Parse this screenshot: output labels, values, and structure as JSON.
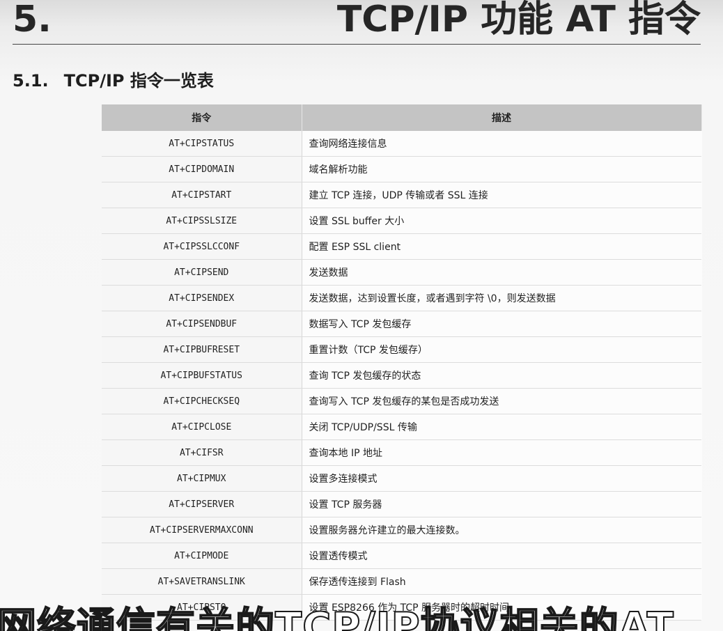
{
  "chapter": {
    "number": "5.",
    "title": "TCP/IP 功能 AT 指令"
  },
  "section": {
    "number": "5.1.",
    "title": "TCP/IP 指令一览表"
  },
  "table": {
    "headers": [
      "指令",
      "描述"
    ],
    "rows": [
      {
        "command": "AT+CIPSTATUS",
        "description": "查询网络连接信息"
      },
      {
        "command": "AT+CIPDOMAIN",
        "description": "域名解析功能"
      },
      {
        "command": "AT+CIPSTART",
        "description": "建立 TCP 连接，UDP 传输或者 SSL 连接"
      },
      {
        "command": "AT+CIPSSLSIZE",
        "description": "设置 SSL buffer 大小"
      },
      {
        "command": "AT+CIPSSLCCONF",
        "description": "配置 ESP SSL client"
      },
      {
        "command": "AT+CIPSEND",
        "description": "发送数据"
      },
      {
        "command": "AT+CIPSENDEX",
        "description": "发送数据，达到设置长度，或者遇到字符 \\0，则发送数据"
      },
      {
        "command": "AT+CIPSENDBUF",
        "description": "数据写入 TCP 发包缓存"
      },
      {
        "command": "AT+CIPBUFRESET",
        "description": "重置计数（TCP 发包缓存）"
      },
      {
        "command": "AT+CIPBUFSTATUS",
        "description": "查询 TCP 发包缓存的状态"
      },
      {
        "command": "AT+CIPCHECKSEQ",
        "description": "查询写入 TCP 发包缓存的某包是否成功发送"
      },
      {
        "command": "AT+CIPCLOSE",
        "description": "关闭 TCP/UDP/SSL 传输"
      },
      {
        "command": "AT+CIFSR",
        "description": "查询本地 IP 地址"
      },
      {
        "command": "AT+CIPMUX",
        "description": "设置多连接模式"
      },
      {
        "command": "AT+CIPSERVER",
        "description": "设置 TCP 服务器"
      },
      {
        "command": "AT+CIPSERVERMAXCONN",
        "description": "设置服务器允许建立的最大连接数。"
      },
      {
        "command": "AT+CIPMODE",
        "description": "设置透传模式"
      },
      {
        "command": "AT+SAVETRANSLINK",
        "description": "保存透传连接到 Flash"
      },
      {
        "command": "AT+CIPSTO",
        "description": "设置 ESP8266 作为 TCP 服务器时的超时时间"
      }
    ]
  },
  "subtitle": "网络通信有关的TCP/IP协议相关的AT"
}
